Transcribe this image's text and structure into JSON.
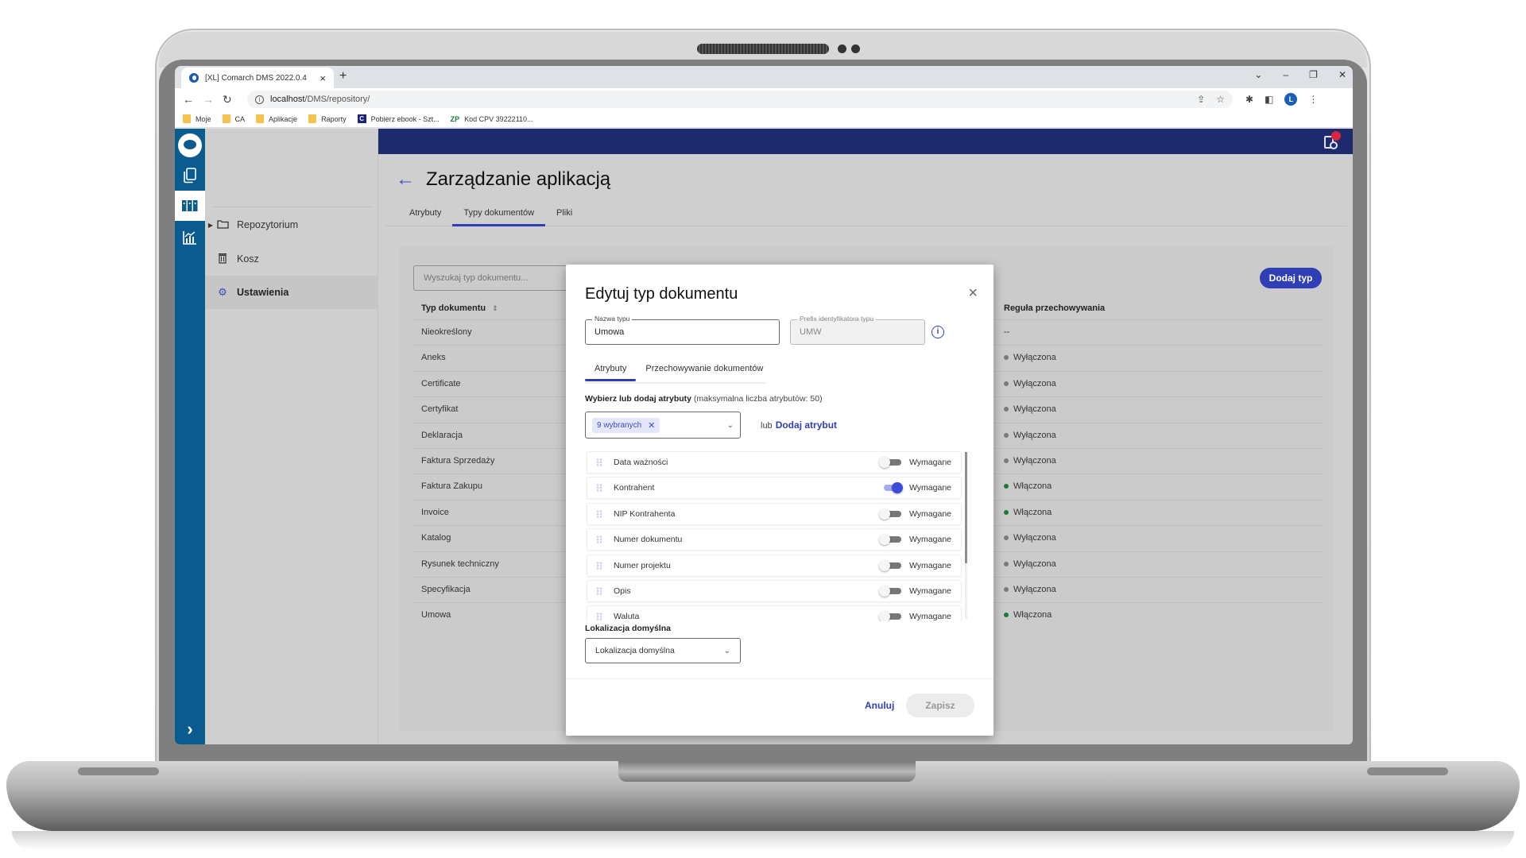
{
  "browser": {
    "tab_title": "[XL] Comarch DMS 2022.0.4",
    "tab_close": "×",
    "new_tab": "+",
    "url_host": "localhost",
    "url_path": "/DMS/repository/",
    "profile_initial": "L",
    "window_controls": [
      "⌄",
      "–",
      "❐",
      "✕"
    ],
    "bookmarks": [
      {
        "label": "Moje",
        "icon": "folder-icon"
      },
      {
        "label": "CA",
        "icon": "folder-icon"
      },
      {
        "label": "Aplikacje",
        "icon": "folder-icon"
      },
      {
        "label": "Raporty",
        "icon": "folder-icon"
      },
      {
        "label": "Pobierz ebook - Szt...",
        "icon": "c-icon",
        "glyph": "C"
      },
      {
        "label": "Kod CPV 39222110...",
        "icon": "zp-icon",
        "glyph": "ZP"
      }
    ]
  },
  "nav": {
    "items": [
      {
        "label": "Repozytorium",
        "icon": "folder-icon"
      },
      {
        "label": "Kosz",
        "icon": "trash-icon"
      },
      {
        "label": "Ustawienia",
        "icon": "gear-icon",
        "active": true
      }
    ]
  },
  "page": {
    "title": "Zarządzanie aplikacją",
    "tabs": [
      {
        "label": "Atrybuty"
      },
      {
        "label": "Typy dokumentów",
        "active": true
      },
      {
        "label": "Pliki"
      }
    ],
    "search_placeholder": "Wyszukaj typ dokumentu...",
    "add_button": "Dodaj typ",
    "table": {
      "col_type": "Typ dokumentu",
      "col_rule": "Reguła przechowywania",
      "rows": [
        {
          "type": "Nieokreślony",
          "rule": "--",
          "status": "none"
        },
        {
          "type": "Aneks",
          "rule": "Wyłączona",
          "status": "off"
        },
        {
          "type": "Certificate",
          "rule": "Wyłączona",
          "status": "off"
        },
        {
          "type": "Certyfikat",
          "rule": "Wyłączona",
          "status": "off"
        },
        {
          "type": "Deklaracja",
          "rule": "Wyłączona",
          "status": "off"
        },
        {
          "type": "Faktura Sprzedaży",
          "rule": "Wyłączona",
          "status": "off"
        },
        {
          "type": "Faktura Zakupu",
          "rule": "Włączona",
          "status": "on"
        },
        {
          "type": "Invoice",
          "rule": "Włączona",
          "status": "on"
        },
        {
          "type": "Katalog",
          "rule": "Wyłączona",
          "status": "off"
        },
        {
          "type": "Rysunek techniczny",
          "rule": "Wyłączona",
          "status": "off"
        },
        {
          "type": "Specyfikacja",
          "rule": "Wyłączona",
          "status": "off"
        },
        {
          "type": "Umowa",
          "rule": "Włączona",
          "status": "on"
        }
      ]
    }
  },
  "colors": {
    "brand_rail": "#0b5b8f",
    "topbar": "#1e2a6e",
    "accent": "#2f3fb5",
    "status_on": "#1b7a3a",
    "status_off": "#7a7a7a"
  },
  "modal": {
    "title": "Edytuj typ dokumentu",
    "close": "×",
    "name_label": "Nazwa typu",
    "name_value": "Umowa",
    "prefix_label": "Prefix identyfikatora typu",
    "prefix_value": "UMW",
    "info_glyph": "i",
    "tabs": [
      {
        "label": "Atrybuty",
        "active": true
      },
      {
        "label": "Przechowywanie dokumentów"
      }
    ],
    "hint_bold": "Wybierz lub dodaj atrybuty",
    "hint_rest": " (maksymalna liczba atrybutów: 50)",
    "chip_label": "9 wybranych",
    "chip_remove": "✕",
    "or_text": "lub",
    "add_attr_link": "Dodaj atrybut",
    "required_label": "Wymagane",
    "attributes": [
      {
        "name": "Data ważności",
        "required": false
      },
      {
        "name": "Kontrahent",
        "required": true
      },
      {
        "name": "NIP Kontrahenta",
        "required": false
      },
      {
        "name": "Numer dokumentu",
        "required": false
      },
      {
        "name": "Numer projektu",
        "required": false
      },
      {
        "name": "Opis",
        "required": false
      },
      {
        "name": "Waluta",
        "required": false
      }
    ],
    "location_label": "Lokalizacja domyślna",
    "location_value": "Lokalizacja domyślna",
    "cancel": "Anuluj",
    "save": "Zapisz"
  }
}
